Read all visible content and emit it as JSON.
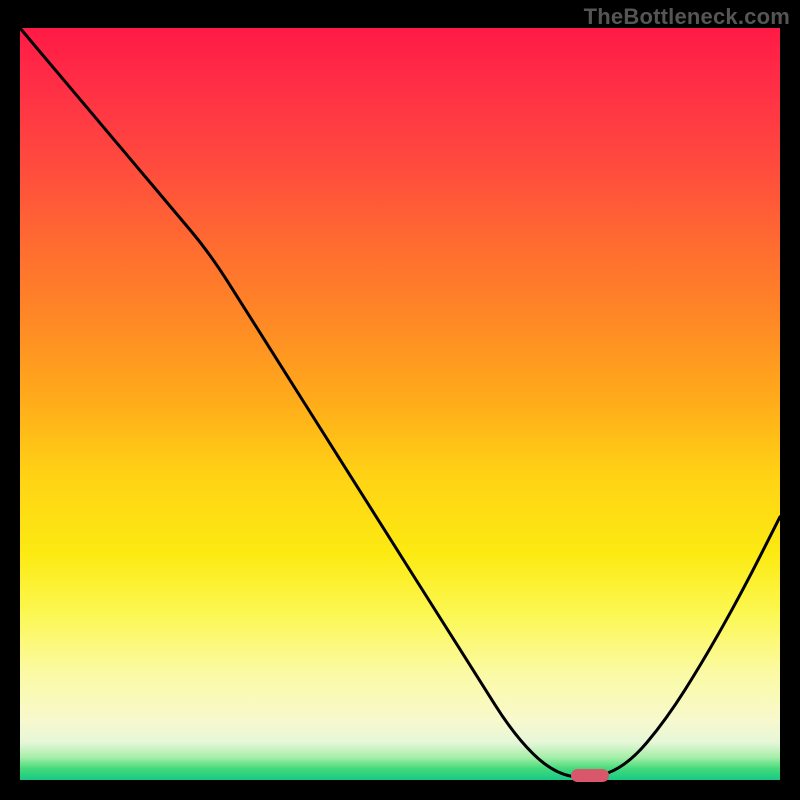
{
  "watermark": "TheBottleneck.com",
  "colors": {
    "page_bg": "#000000",
    "watermark": "#555555",
    "curve": "#000000",
    "marker": "#d8576b",
    "gradient_top": "#ff1a45",
    "gradient_bottom": "#17c987"
  },
  "chart_data": {
    "type": "line",
    "title": "",
    "xlabel": "",
    "ylabel": "",
    "xlim": [
      0,
      100
    ],
    "ylim": [
      0,
      100
    ],
    "x": [
      0,
      5,
      10,
      15,
      20,
      25,
      30,
      35,
      40,
      45,
      50,
      55,
      60,
      65,
      70,
      75,
      80,
      85,
      90,
      95,
      100
    ],
    "values": [
      100,
      94,
      88,
      82,
      76,
      70,
      62,
      54,
      46,
      38,
      30,
      22,
      14,
      6,
      1,
      0,
      2,
      8,
      16,
      25,
      35
    ],
    "annotations": [
      {
        "name": "optimal-marker",
        "x": 75,
        "y": 0
      }
    ]
  }
}
